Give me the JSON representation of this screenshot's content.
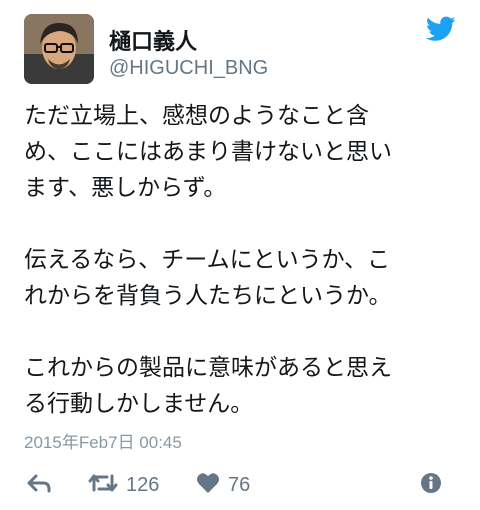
{
  "user": {
    "display_name": "樋口義人",
    "handle": "@HIGUCHI_BNG"
  },
  "tweet": {
    "paragraphs": [
      "ただ立場上、感想のようなこと含\nめ、ここにはあまり書けないと思い\nます、悪しからず。",
      "伝えるなら、チームにというか、こ\nれからを背負う人たちにというか。",
      "これからの製品に意味があると思え\nる行動しかしません。"
    ],
    "timestamp": "2015年Feb7日 00:45"
  },
  "actions": {
    "reply_icon": "reply-icon",
    "retweet_icon": "retweet-icon",
    "retweet_count": "126",
    "like_icon": "heart-icon",
    "like_count": "76",
    "more_icon": "info-icon"
  },
  "colors": {
    "text": "#14171a",
    "secondary": "#657786",
    "timestamp": "#8899a6",
    "twitter_blue": "#1da1f2"
  }
}
